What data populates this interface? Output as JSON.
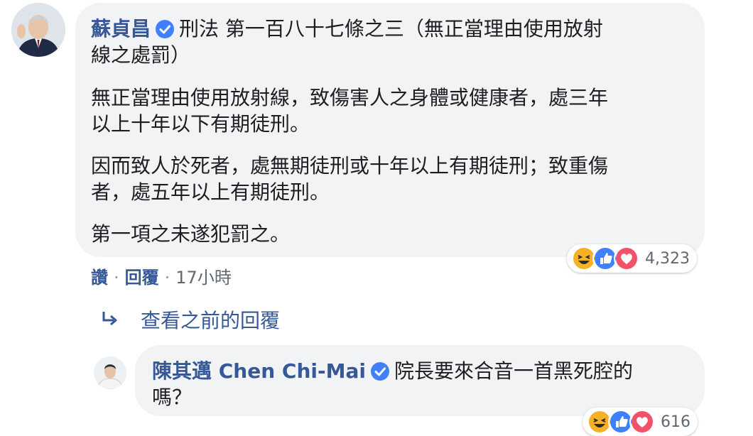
{
  "colors": {
    "name": "#365899",
    "bubble": "#f2f3f5",
    "verified": "#4080ff",
    "meta": "#606770"
  },
  "main_comment": {
    "author": "蘇貞昌",
    "verified_icon": "verified-badge-icon",
    "line1": "刑法 第一百八十七條之三（無正當理由使用放射",
    "line2": "線之處罰）",
    "p1_line1": "無正當理由使用放射線，致傷害人之身體或健康者，處三年",
    "p1_line2": "以上十年以下有期徒刑。",
    "p2_line1": "因而致人於死者，處無期徒刑或十年以上有期徒刑；致重傷",
    "p2_line2": "者，處五年以上有期徒刑。",
    "p3_line1": "第一項之未遂犯罰之。",
    "reactions": [
      "haha-icon",
      "like-icon",
      "love-icon"
    ],
    "reaction_count": "4,323",
    "like_label": "讚",
    "reply_label": "回覆",
    "time": "17小時"
  },
  "view_previous": {
    "icon": "reply-arrow-icon",
    "label": "查看之前的回覆"
  },
  "reply_comment": {
    "author": "陳其邁 Chen Chi-Mai",
    "verified_icon": "verified-badge-icon",
    "text_line1": "院長要來合音一首黑死腔的",
    "text_line2": "嗎？",
    "reactions": [
      "haha-icon",
      "like-icon",
      "love-icon"
    ],
    "reaction_count": "616"
  }
}
